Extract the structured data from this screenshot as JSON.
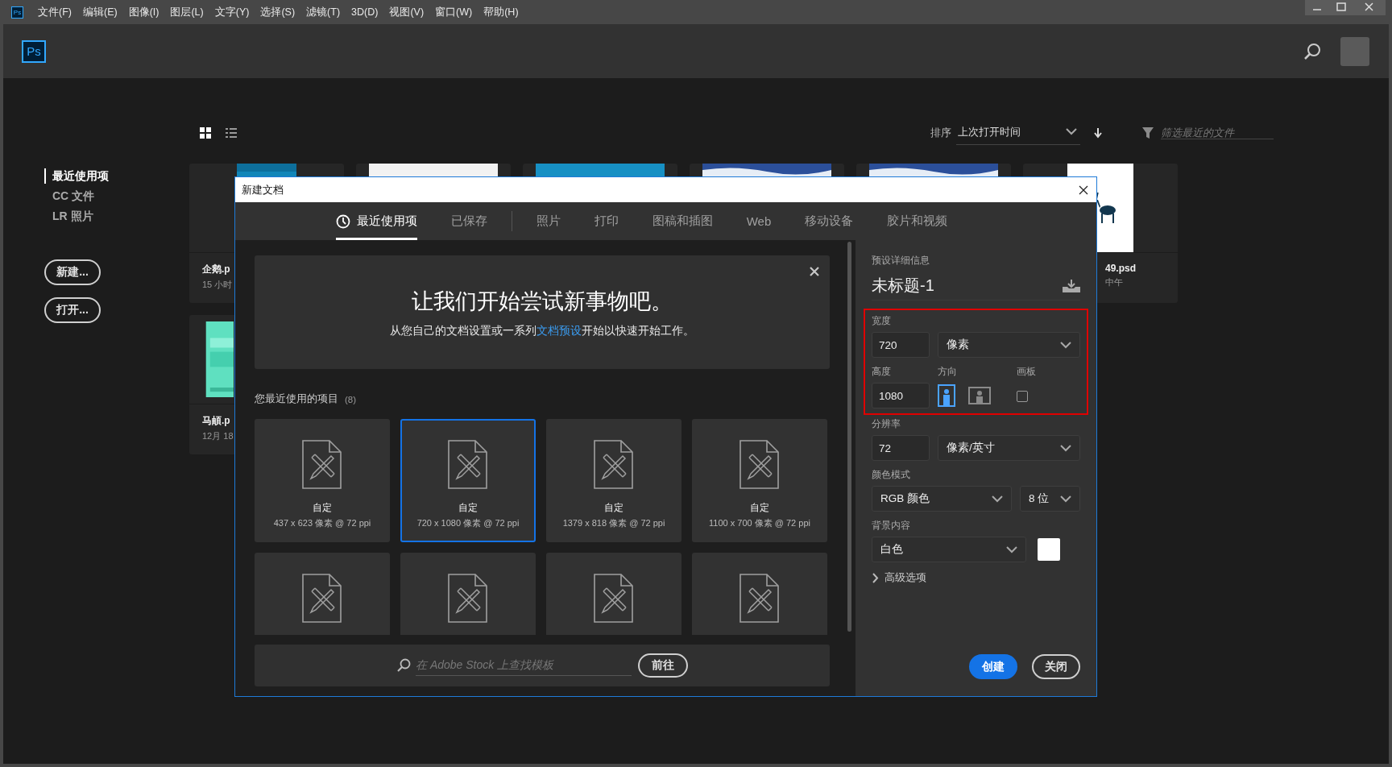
{
  "menu_bar": {
    "app_icon": "Ps",
    "items": [
      "文件(F)",
      "编辑(E)",
      "图像(I)",
      "图层(L)",
      "文字(Y)",
      "选择(S)",
      "滤镜(T)",
      "3D(D)",
      "视图(V)",
      "窗口(W)",
      "帮助(H)"
    ]
  },
  "header": {
    "logo": "Ps"
  },
  "home": {
    "sidebar": {
      "items": [
        {
          "label": "最近使用项",
          "selected": true
        },
        {
          "label": "CC 文件",
          "selected": false
        },
        {
          "label": "LR 照片",
          "selected": false
        }
      ]
    },
    "buttons": [
      "新建...",
      "打开..."
    ],
    "view_modes": [
      {
        "kind": "grid",
        "selected": true
      },
      {
        "kind": "list",
        "selected": false
      }
    ],
    "sort": {
      "label": "排序",
      "value": "上次打开时间"
    },
    "filter": {
      "placeholder": "筛选最近的文件"
    },
    "recent_files": [
      {
        "kind": "picture",
        "name": "企鹅.p",
        "time": "15 小时"
      },
      {
        "kind": "picture"
      },
      {
        "kind": "picture"
      },
      {
        "kind": "picture"
      },
      {
        "kind": "picture"
      },
      {
        "kind": "picture",
        "name": "49.psd",
        "time": "中午"
      },
      {
        "kind": "picture",
        "name": "马頔.p",
        "time": "12月 18"
      }
    ]
  },
  "dialog": {
    "title": "新建文档",
    "tabs": [
      {
        "label": "最近使用项",
        "selected": true
      },
      {
        "label": "已保存",
        "selected": false
      },
      {
        "label": "照片",
        "selected": false
      },
      {
        "label": "打印",
        "selected": false
      },
      {
        "label": "图稿和插图",
        "selected": false
      },
      {
        "label": "Web",
        "selected": false
      },
      {
        "label": "移动设备",
        "selected": false
      },
      {
        "label": "胶片和视频",
        "selected": false
      }
    ],
    "banner": {
      "title": "让我们开始尝试新事物吧。",
      "text": "从您自己的文档设置或一系列",
      "link": "文档预设",
      "text_after": "开始以快速开始工作。"
    },
    "recent": {
      "heading": "您最近使用的项目",
      "count": "(8)",
      "items": [
        {
          "name": "自定",
          "size": "437 x 623 像素 @ 72 ppi",
          "selected": false
        },
        {
          "name": "自定",
          "size": "720 x 1080 像素 @ 72 ppi",
          "selected": true
        },
        {
          "name": "自定",
          "size": "1379 x 818 像素 @ 72 ppi",
          "selected": false
        },
        {
          "name": "自定",
          "size": "1100 x 700 像素 @ 72 ppi",
          "selected": false
        },
        {
          "selected": false
        },
        {
          "selected": false
        },
        {
          "selected": false
        },
        {
          "selected": false
        }
      ]
    },
    "stock_search": {
      "placeholder": "在 Adobe Stock 上查找模板",
      "button": "前往"
    },
    "details": {
      "heading": "预设详细信息",
      "name": "未标题-1",
      "highlighted": true,
      "width": {
        "label": "宽度",
        "value": "720",
        "unit": "像素"
      },
      "height": {
        "label": "高度",
        "value": "1080"
      },
      "orientation": {
        "label": "方向",
        "options": [
          {
            "kind": "portrait",
            "selected": true
          },
          {
            "kind": "landscape",
            "selected": false
          }
        ]
      },
      "artboard": {
        "label": "画板",
        "checked": false
      },
      "resolution": {
        "label": "分辨率",
        "value": "72",
        "unit": "像素/英寸"
      },
      "color_mode": {
        "label": "颜色模式",
        "value": "RGB 颜色",
        "depth": "8 位"
      },
      "background": {
        "label": "背景内容",
        "value": "白色",
        "color": "#ffffff"
      },
      "advanced": {
        "label": "高级选项",
        "expanded": false
      }
    },
    "buttons": [
      {
        "label": "创建",
        "kind": "primary"
      },
      {
        "label": "关闭",
        "kind": "secondary"
      }
    ]
  }
}
